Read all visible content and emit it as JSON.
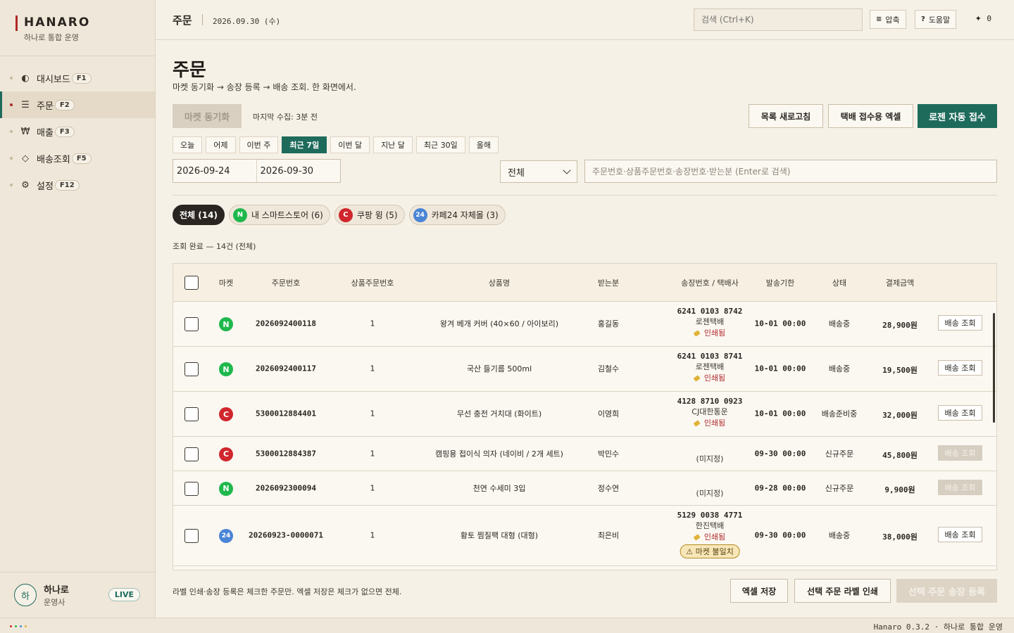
{
  "brand": {
    "name": "HANARO",
    "sub": "하나로 통합 운영"
  },
  "nav": [
    {
      "icon": "◐",
      "label": "대시보드",
      "key": "F1",
      "active": false
    },
    {
      "icon": "☰",
      "label": "주문",
      "key": "F2",
      "active": true
    },
    {
      "icon": "₩",
      "label": "매출",
      "key": "F3",
      "active": false
    },
    {
      "icon": "◇",
      "label": "배송조회",
      "key": "F5",
      "active": false
    },
    {
      "icon": "⚙",
      "label": "설정",
      "key": "F12",
      "active": false
    }
  ],
  "user": {
    "avatar": "하",
    "name": "하나로",
    "role": "운영사",
    "status": "LIVE"
  },
  "topbar": {
    "title": "주문",
    "date": "2026.09.30 (수)",
    "search_placeholder": "검색 (Ctrl+K)",
    "compress_icon": "≡",
    "compress_label": "압축",
    "help_icon": "?",
    "help_label": "도움말",
    "spark_icon": "✦",
    "spark_count": "0"
  },
  "page": {
    "title": "주문",
    "desc": "마켓 동기화 → 송장 등록 → 배송 조회. 한 화면에서.",
    "sync_label": "마켓 동기화",
    "last_sync": "마지막 수집: 3분 전",
    "refresh_label": "목록 새로고침",
    "excel_courier_label": "택배 접수용 엑셀",
    "logen_label": "로젠 자동 접수"
  },
  "ranges": [
    {
      "label": "오늘",
      "active": false
    },
    {
      "label": "어제",
      "active": false
    },
    {
      "label": "이번 주",
      "active": false
    },
    {
      "label": "최근 7일",
      "active": true
    },
    {
      "label": "이번 달",
      "active": false
    },
    {
      "label": "지난 달",
      "active": false
    },
    {
      "label": "최근 30일",
      "active": false
    },
    {
      "label": "올해",
      "active": false
    }
  ],
  "filters": {
    "date_from": "2026-09-24",
    "date_to": "2026-09-30",
    "select_value": "전체",
    "query_placeholder": "주문번호·상품주문번호·송장번호·받는분 (Enter로 검색)"
  },
  "chips": [
    {
      "badge": "",
      "kind": "",
      "label": "전체 (14)",
      "active": true
    },
    {
      "badge": "N",
      "kind": "n",
      "label": "내 스마트스토어 (6)",
      "active": false
    },
    {
      "badge": "C",
      "kind": "c",
      "label": "쿠팡 윙 (5)",
      "active": false
    },
    {
      "badge": "24",
      "kind": "t",
      "label": "카페24 자체몰 (3)",
      "active": false
    }
  ],
  "status_line": "조회 완료 — 14건 (전체)",
  "table": {
    "headers": [
      "마켓",
      "주문번호",
      "상품주문번호",
      "상품명",
      "받는분",
      "송장번호 / 택배사",
      "발송기한",
      "상태",
      "결제금액"
    ],
    "rows": [
      {
        "market": "N",
        "kind": "n",
        "order": "2026092400118",
        "item_no": "1",
        "product": "왕겨 베개 커버 (40×60 / 아이보리)",
        "recipient": "홍길동",
        "invoice": "6241 0103 8742",
        "carrier": "로젠택배",
        "printed": "인쇄됨",
        "warn": "",
        "deadline": "10-01 00:00",
        "status": "배송중",
        "amount": "28,900원",
        "action": "배송 조회",
        "enabled": true
      },
      {
        "market": "N",
        "kind": "n",
        "order": "2026092400117",
        "item_no": "1",
        "product": "국산 들기름 500ml",
        "recipient": "김철수",
        "invoice": "6241 0103 8741",
        "carrier": "로젠택배",
        "printed": "인쇄됨",
        "warn": "",
        "deadline": "10-01 00:00",
        "status": "배송중",
        "amount": "19,500원",
        "action": "배송 조회",
        "enabled": true
      },
      {
        "market": "C",
        "kind": "c",
        "order": "5300012884401",
        "item_no": "1",
        "product": "무선 충전 거치대 (화이트)",
        "recipient": "이영희",
        "invoice": "4128 8710 0923",
        "carrier": "CJ대한통운",
        "printed": "인쇄됨",
        "warn": "",
        "deadline": "10-01 00:00",
        "status": "배송준비중",
        "amount": "32,000원",
        "action": "배송 조회",
        "enabled": true
      },
      {
        "market": "C",
        "kind": "c",
        "order": "5300012884387",
        "item_no": "1",
        "product": "캠핑용 접이식 의자 (네이비 / 2개 세트)",
        "recipient": "박민수",
        "invoice": "",
        "carrier": "(미지정)",
        "printed": "",
        "warn": "",
        "deadline": "09-30 00:00",
        "status": "신규주문",
        "amount": "45,800원",
        "action": "배송 조회",
        "enabled": false
      },
      {
        "market": "N",
        "kind": "n",
        "order": "2026092300094",
        "item_no": "1",
        "product": "천연 수세미 3입",
        "recipient": "정수연",
        "invoice": "",
        "carrier": "(미지정)",
        "printed": "",
        "warn": "",
        "deadline": "09-28 00:00",
        "status": "신규주문",
        "amount": "9,900원",
        "action": "배송 조회",
        "enabled": false
      },
      {
        "market": "24",
        "kind": "t",
        "order": "20260923-0000071",
        "item_no": "1",
        "product": "황토 찜질팩 대형 (대형)",
        "recipient": "최은비",
        "invoice": "5129 0038 4771",
        "carrier": "한진택배",
        "printed": "인쇄됨",
        "warn": "⚠ 마켓 불일치",
        "deadline": "09-30 00:00",
        "status": "배송중",
        "amount": "38,000원",
        "action": "배송 조회",
        "enabled": true
      }
    ]
  },
  "footer": {
    "note": "라벨 인쇄·송장 등록은 체크한 주문만. 엑셀 저장은 체크가 없으면 전체.",
    "excel_label": "엑셀 저장",
    "print_label": "선택 주문 라벨 인쇄",
    "register_label": "선택 주문 송장 등록"
  },
  "statusbar": {
    "version": "Hanaro 0.3.2 · 하나로 통합 운영",
    "dot_colors": [
      "#d0262d",
      "#1fb84d",
      "#4a85d6",
      "#e0b236"
    ]
  }
}
